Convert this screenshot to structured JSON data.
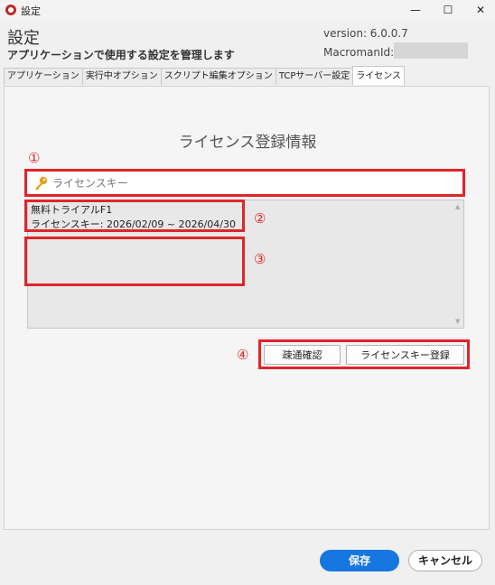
{
  "window": {
    "title": "設定",
    "minimize": "—",
    "maximize": "☐",
    "close": "✕"
  },
  "header": {
    "title": "設定",
    "subtitle": "アプリケーションで使用する設定を管理します",
    "version_label": "version: 6.0.0.7",
    "macroman_label": "MacromanId:",
    "macroman_value": ""
  },
  "tabs": [
    {
      "label": "アプリケーション"
    },
    {
      "label": "実行中オプション"
    },
    {
      "label": "スクリプト編集オプション"
    },
    {
      "label": "TCPサーバー設定"
    },
    {
      "label": "ライセンス"
    }
  ],
  "license": {
    "title": "ライセンス登録情報",
    "input_placeholder": "ライセンスキー",
    "info_line1": "無料トライアルF1",
    "info_line2": "ライセンスキー: 2026/02/09 ~ 2026/04/30",
    "check_button": "疎通確認",
    "register_button": "ライセンスキー登録"
  },
  "markers": [
    "①",
    "②",
    "③",
    "④"
  ],
  "footer": {
    "save": "保存",
    "cancel": "キャンセル"
  },
  "colors": {
    "accent": "#1677e0",
    "highlight": "#e0242a"
  },
  "icons": {
    "app": "app-icon",
    "key": "key-icon"
  }
}
